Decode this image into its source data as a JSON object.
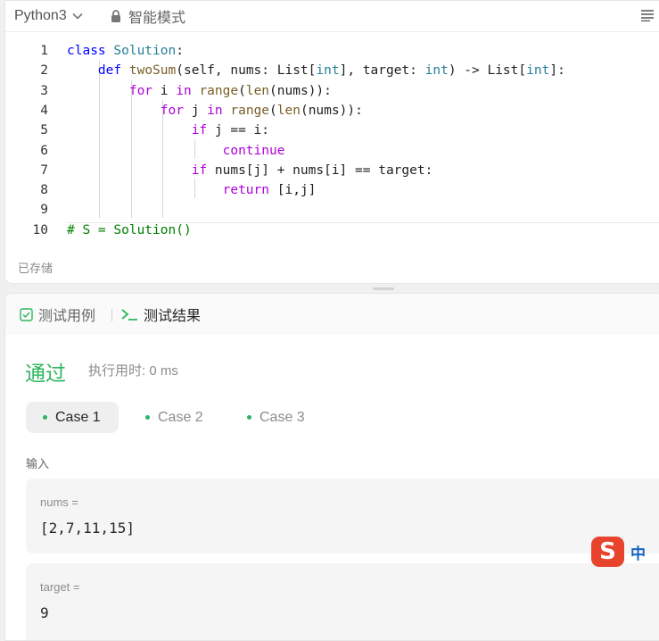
{
  "editor": {
    "language": "Python3",
    "mode": "智能模式",
    "saved_status": "已存储",
    "code_lines": [
      {
        "num": "1",
        "html": "<span class=\"kw\">class</span> <span class=\"cls\">Solution</span>:"
      },
      {
        "num": "2",
        "html": "    <span class=\"kw\">def</span> <span class=\"fn\">twoSum</span>(self, nums: List[<span class=\"ty\">int</span>], target: <span class=\"ty\">int</span>) -> List[<span class=\"ty\">int</span>]:"
      },
      {
        "num": "3",
        "html": "        <span class=\"kw2\">for</span> i <span class=\"kw2\">in</span> <span class=\"fn\">range</span>(<span class=\"fn\">len</span>(nums)):"
      },
      {
        "num": "4",
        "html": "            <span class=\"kw2\">for</span> j <span class=\"kw2\">in</span> <span class=\"fn\">range</span>(<span class=\"fn\">len</span>(nums)):"
      },
      {
        "num": "5",
        "html": "                <span class=\"kw2\">if</span> j == i:"
      },
      {
        "num": "6",
        "html": "                    <span class=\"kw2\">continue</span>"
      },
      {
        "num": "7",
        "html": "                <span class=\"kw2\">if</span> nums[j] + nums[i] == target:"
      },
      {
        "num": "8",
        "html": "                    <span class=\"kw2\">return</span> [i,j]"
      },
      {
        "num": "9",
        "html": ""
      },
      {
        "num": "10",
        "html": "<span class=\"cm\"># S = Solution()</span>"
      }
    ]
  },
  "result": {
    "tab_testcase": "测试用例",
    "tab_result": "测试结果",
    "status": "通过",
    "runtime": "执行用时: 0 ms",
    "cases": [
      "Case 1",
      "Case 2",
      "Case 3"
    ],
    "input_label": "输入",
    "inputs": [
      {
        "name": "nums =",
        "value": "[2,7,11,15]"
      },
      {
        "name": "target =",
        "value": "9"
      }
    ]
  },
  "ime": {
    "logo_letter": "S",
    "lang": "中"
  },
  "colors": {
    "accent_green": "#2db55d",
    "ime_red": "#e8442d",
    "ime_blue": "#1565c0"
  }
}
